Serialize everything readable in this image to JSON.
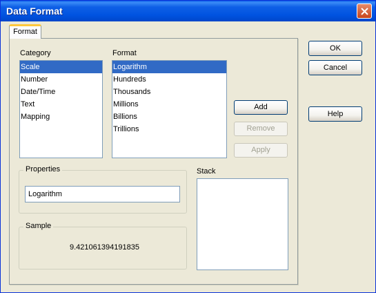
{
  "window": {
    "title": "Data Format"
  },
  "tabs": [
    {
      "label": "Format"
    }
  ],
  "category": {
    "label": "Category",
    "items": [
      "Scale",
      "Number",
      "Date/Time",
      "Text",
      "Mapping"
    ],
    "selected": "Scale"
  },
  "format": {
    "label": "Format",
    "items": [
      "Logarithm",
      "Hundreds",
      "Thousands",
      "Millions",
      "Billions",
      "Trillions"
    ],
    "selected": "Logarithm"
  },
  "actions": {
    "add": "Add",
    "remove": "Remove",
    "apply": "Apply"
  },
  "properties": {
    "label": "Properties",
    "value": "Logarithm"
  },
  "sample": {
    "label": "Sample",
    "value": "9.421061394191835"
  },
  "stack": {
    "label": "Stack"
  },
  "dialog_buttons": {
    "ok": "OK",
    "cancel": "Cancel",
    "help": "Help"
  },
  "icons": {
    "close": "close-icon"
  },
  "colors": {
    "selection": "#316ac5",
    "tab_highlight": "#ffc83c",
    "titlebar": "#0053e0"
  }
}
